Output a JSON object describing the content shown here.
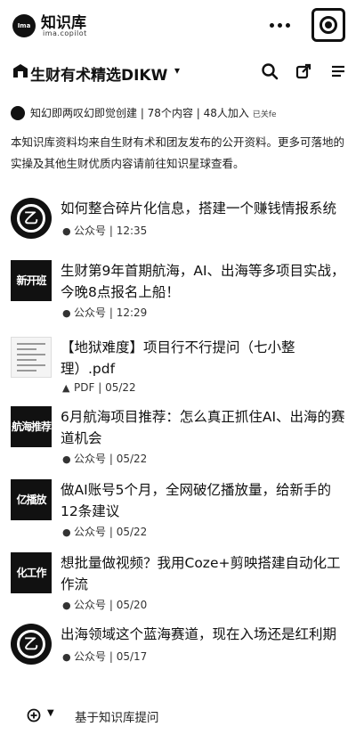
{
  "topbar": {
    "logo_mark": "Ima",
    "app_title": "知识库",
    "app_subtitle": "ima.copilot"
  },
  "knowledge_base": {
    "name": "生财有术精选DIKW",
    "creator_line": "知幻即两叹幻即觉创建 | 78个内容 | 48人加入",
    "creator_tag": "已关fe",
    "description": "本知识库资料均来自生财有术和团友发布的公开资料。更多可落地的实操及其他生财优质内容请前往知识星球查看。"
  },
  "items": [
    {
      "thumb_type": "circle",
      "thumb_text": "乙",
      "title": "如何整合碎片化信息，搭建一个赚钱情报系统",
      "source": "公众号",
      "time": "12:35",
      "source_icon": "wechat-icon"
    },
    {
      "thumb_type": "square",
      "thumb_text": "新开班",
      "title": "生财第9年首期航海，AI、出海等多项目实战，今晚8点报名上船！",
      "source": "公众号",
      "time": "12:29",
      "source_icon": "wechat-icon"
    },
    {
      "thumb_type": "pdf",
      "thumb_text": "",
      "title": "【地狱难度】项目行不行提问（七小整理）.pdf",
      "source": "PDF",
      "time": "05/22",
      "source_icon": "pdf-icon"
    },
    {
      "thumb_type": "square",
      "thumb_text": "航海推荐",
      "title": "6月航海项目推荐：怎么真正抓住AI、出海的赛道机会",
      "source": "公众号",
      "time": "05/22",
      "source_icon": "wechat-icon"
    },
    {
      "thumb_type": "square",
      "thumb_text": "亿播放",
      "title": "做AI账号5个月，全网破亿播放量，给新手的12条建议",
      "source": "公众号",
      "time": "05/22",
      "source_icon": "wechat-icon"
    },
    {
      "thumb_type": "square",
      "thumb_text": "化工作",
      "title": "想批量做视频？我用Coze+剪映搭建自动化工作流",
      "source": "公众号",
      "time": "05/20",
      "source_icon": "wechat-icon"
    },
    {
      "thumb_type": "circle",
      "thumb_text": "乙",
      "title": "出海领域这个蓝海赛道，现在入场还是红利期",
      "source": "公众号",
      "time": "05/17",
      "source_icon": "wechat-icon"
    }
  ],
  "bottom_bar": {
    "prompt": "基于知识库提问"
  }
}
